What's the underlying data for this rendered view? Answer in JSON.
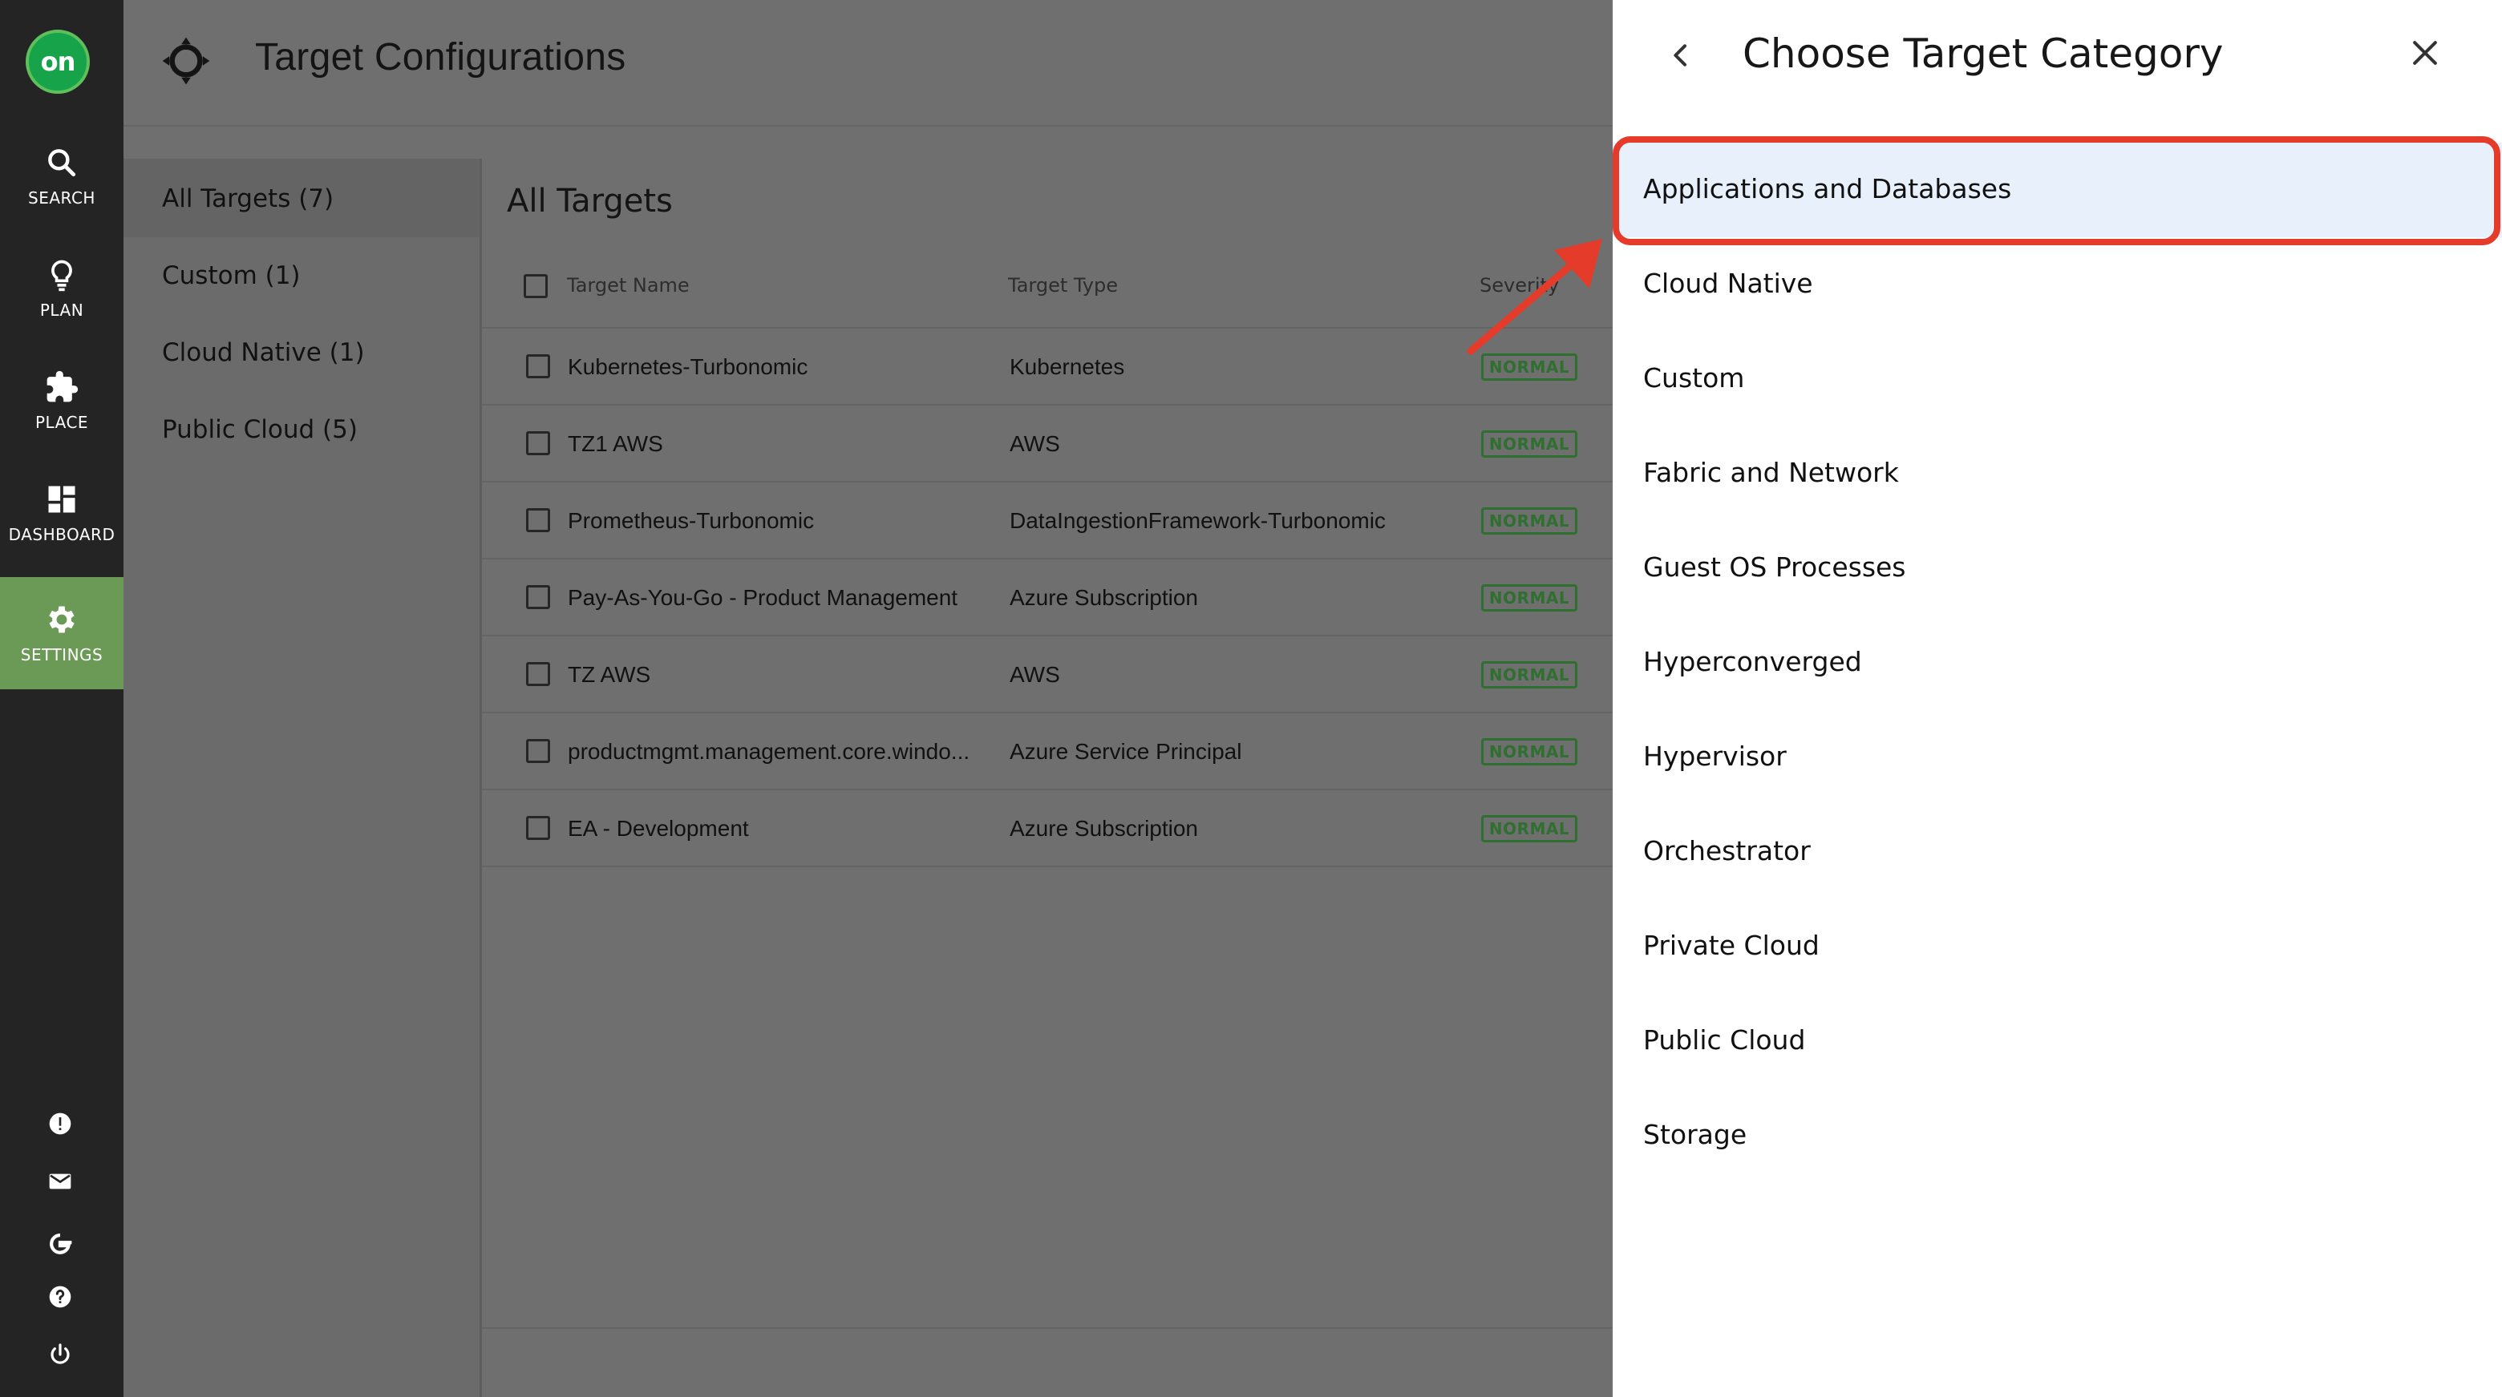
{
  "nav": {
    "logo_text": "on",
    "items": [
      {
        "label": "SEARCH",
        "icon": "search-icon"
      },
      {
        "label": "PLAN",
        "icon": "lightbulb-icon"
      },
      {
        "label": "PLACE",
        "icon": "puzzle-icon"
      },
      {
        "label": "DASHBOARD",
        "icon": "dashboard-icon"
      },
      {
        "label": "SETTINGS",
        "icon": "gear-icon",
        "active": true
      }
    ],
    "bottom_icons": [
      "alert-icon",
      "mail-icon",
      "google-icon",
      "help-icon",
      "power-icon"
    ]
  },
  "header": {
    "title": "Target Configurations",
    "icon": "crosshair-icon"
  },
  "categories": [
    {
      "label": "All Targets (7)",
      "active": true
    },
    {
      "label": "Custom (1)"
    },
    {
      "label": "Cloud Native (1)"
    },
    {
      "label": "Public Cloud (5)"
    }
  ],
  "targets": {
    "title": "All Targets",
    "columns": {
      "name": "Target Name",
      "type": "Target Type",
      "severity": "Severity"
    },
    "rows": [
      {
        "name": "Kubernetes-Turbonomic",
        "type": "Kubernetes",
        "severity": "NORMAL"
      },
      {
        "name": "TZ1 AWS",
        "type": "AWS",
        "severity": "NORMAL"
      },
      {
        "name": "Prometheus-Turbonomic",
        "type": "DataIngestionFramework-Turbonomic",
        "severity": "NORMAL"
      },
      {
        "name": "Pay-As-You-Go - Product Management",
        "type": "Azure Subscription",
        "severity": "NORMAL"
      },
      {
        "name": "TZ AWS",
        "type": "AWS",
        "severity": "NORMAL"
      },
      {
        "name": "productmgmt.management.core.windo...",
        "type": "Azure Service Principal",
        "severity": "NORMAL"
      },
      {
        "name": "EA - Development",
        "type": "Azure Subscription",
        "severity": "NORMAL"
      }
    ]
  },
  "drawer": {
    "title": "Choose Target Category",
    "back_icon": "chevron-left-icon",
    "close_icon": "close-icon",
    "options": [
      {
        "label": "Applications and Databases",
        "selected": true
      },
      {
        "label": "Cloud Native"
      },
      {
        "label": "Custom"
      },
      {
        "label": "Fabric and Network"
      },
      {
        "label": "Guest OS Processes"
      },
      {
        "label": "Hyperconverged"
      },
      {
        "label": "Hypervisor"
      },
      {
        "label": "Orchestrator"
      },
      {
        "label": "Private Cloud"
      },
      {
        "label": "Public Cloud"
      },
      {
        "label": "Storage"
      }
    ]
  },
  "colors": {
    "nav_bg": "#242424",
    "active_nav": "#6a9a55",
    "overlay": "#6f6f6f",
    "highlight": "#e53b2a",
    "selected_option": "#e7f0fb",
    "badge": "#2f6f2f"
  }
}
